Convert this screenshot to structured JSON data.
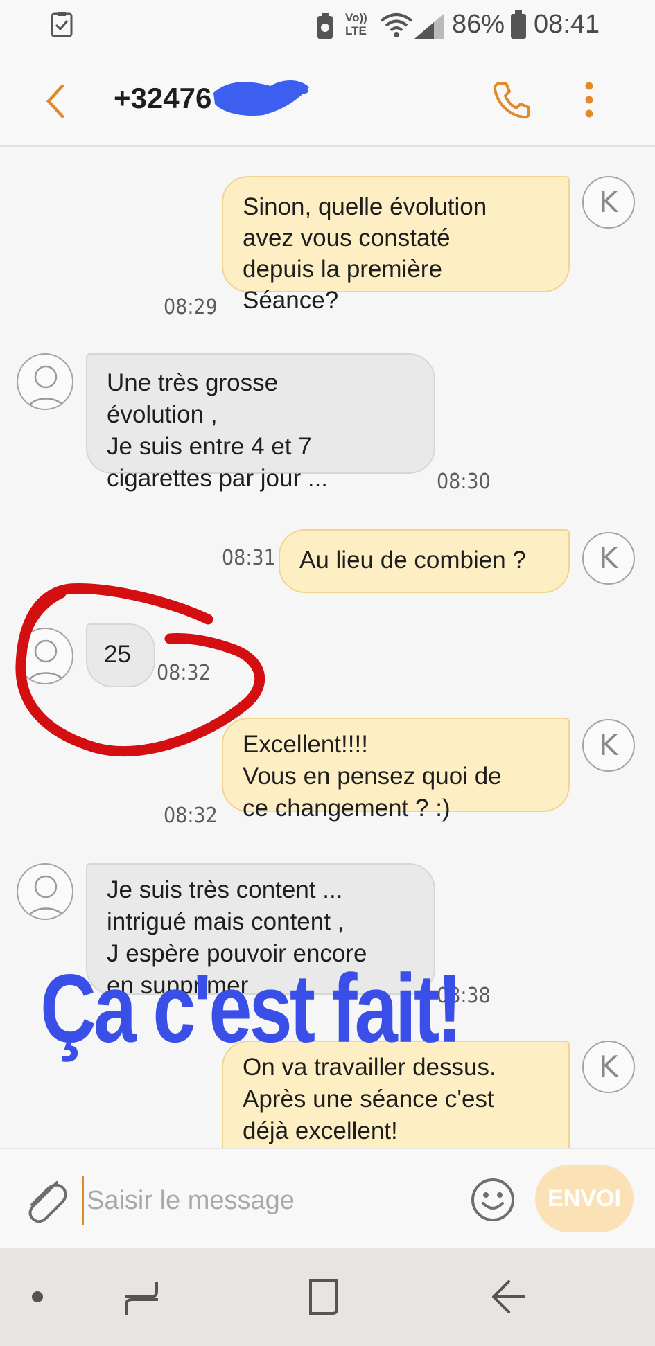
{
  "status_bar": {
    "network": "Vo)) LTE",
    "battery": "86%",
    "time": "08:41"
  },
  "header": {
    "contact_name": "+32476"
  },
  "messages": [
    {
      "direction": "out",
      "text": "Sinon, quelle évolution\navez vous constaté\ndepuis la première\nSéance?",
      "time": "08:29",
      "avatar": "K"
    },
    {
      "direction": "in",
      "text": "Une très grosse\névolution ,\nJe suis entre 4 et 7\ncigarettes par jour ...",
      "time": "08:30"
    },
    {
      "direction": "out",
      "text": "Au lieu de combien ?",
      "time": "08:31",
      "avatar": "K"
    },
    {
      "direction": "in",
      "text": "25",
      "time": "08:32"
    },
    {
      "direction": "out",
      "text": "Excellent!!!!\nVous en pensez quoi de\nce changement ? :)",
      "time": "08:32",
      "avatar": "K"
    },
    {
      "direction": "in",
      "text": "Je suis très content ...\nintrigué mais content ,\nJ espère pouvoir encore\nen supprimer",
      "time": "08:38"
    },
    {
      "direction": "out",
      "text": "On va travailler dessus.\nAprès une séance c'est\ndéjà excellent!",
      "avatar": "K"
    }
  ],
  "overlay": {
    "text": "Ça c'est fait!"
  },
  "composer": {
    "placeholder": "Saisir le message",
    "send_label": "ENVOI"
  },
  "colors": {
    "accent": "#e08a2b",
    "outgoing_bubble": "#fdeec4",
    "incoming_bubble": "#e9e9e9",
    "overlay_text": "#3a4ee8",
    "annotation_circle": "#d40f12",
    "redaction": "#3d5ff0"
  },
  "icons": {
    "status_left": "checklist-icon",
    "back": "chevron-left-icon",
    "call": "phone-icon",
    "more": "more-vertical-icon",
    "attach": "paperclip-icon",
    "emoji": "smiley-icon",
    "nav_dot": "dot-icon",
    "nav_recents": "recents-icon",
    "nav_home": "home-square-icon",
    "nav_back": "nav-back-icon"
  }
}
